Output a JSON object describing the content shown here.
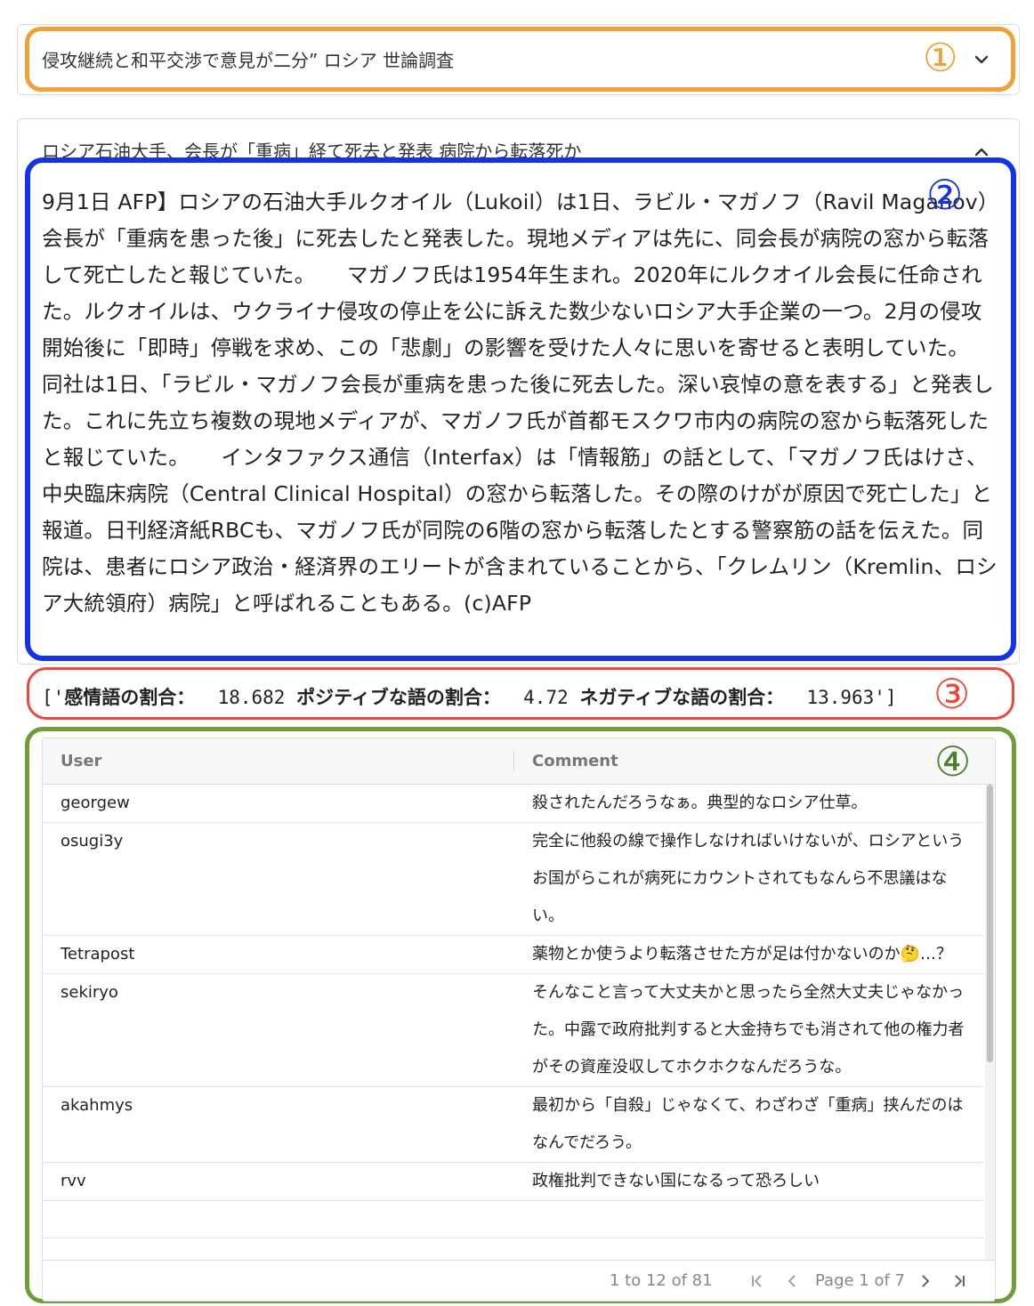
{
  "selector": {
    "selected_value": "侵攻継続と和平交渉で意見が二分” ロシア 世論調査",
    "chevron_icon": "chevron-down-icon"
  },
  "annotations": {
    "one": "①",
    "two": "②",
    "three": "③",
    "four": "④"
  },
  "annotation_colors": {
    "one": "#f0a23a",
    "two": "#1433e6",
    "three": "#e84b3c",
    "four": "#6e9e3a"
  },
  "article": {
    "title": "ロシア石油大手、会長が「重病」経て死去と発表 病院から転落死か",
    "collapse_icon": "chevron-up-icon",
    "body": "9月1日 AFP】ロシアの石油大手ルクオイル（Lukoil）は1日、ラビル・マガノフ（Ravil Maganov）会長が「重病を患った後」に死去したと発表した。現地メディアは先に、同会長が病院の窓から転落して死亡したと報じていた。　　マガノフ氏は1954年生まれ。2020年にルクオイル会長に任命された。ルクオイルは、ウクライナ侵攻の停止を公に訴えた数少ないロシア大手企業の一つ。2月の侵攻開始後に「即時」停戦を求め、この「悲劇」の影響を受けた人々に思いを寄せると表明していた。　　同社は1日、「ラビル・マガノフ会長が重病を患った後に死去した。深い哀悼の意を表する」と発表した。これに先立ち複数の現地メディアが、マガノフ氏が首都モスクワ市内の病院の窓から転落死したと報じていた。　　インタファクス通信（Interfax）は「情報筋」の話として、「マガノフ氏はけさ、中央臨床病院（Central Clinical Hospital）の窓から転落した。その際のけがが原因で死亡した」と報道。日刊経済紙RBCも、マガノフ氏が同院の6階の窓から転落したとする警察筋の話を伝えた。同院は、患者にロシア政治・経済界のエリートが含まれていることから、「クレムリン（Kremlin、ロシア大統領府）病院」と呼ばれることもある。(c)AFP"
  },
  "stats": {
    "open": "['",
    "emotion_label": "感情語の割合：",
    "emotion_value": "18.682",
    "positive_label": "ポジティブな語の割合：",
    "positive_value": "4.72",
    "negative_label": "ネガティブな語の割合：",
    "negative_value": "13.963",
    "close": "']"
  },
  "grid": {
    "columns": [
      "User",
      "Comment"
    ],
    "rows": [
      {
        "user": "georgew",
        "comment": "殺されたんだろうなぁ。典型的なロシア仕草。"
      },
      {
        "user": "osugi3y",
        "comment": "完全に他殺の線で操作しなければいけないが、ロシアというお国がらこれが病死にカウントされてもなんら不思議はない。"
      },
      {
        "user": "Tetrapost",
        "comment": "薬物とか使うより転落させた方が足は付かないのか🤔…？"
      },
      {
        "user": "sekiryo",
        "comment": "そんなこと言って大丈夫かと思ったら全然大丈夫じゃなかった。中露で政府批判すると大金持ちでも消されて他の権力者がその資産没収してホクホクなんだろうな。"
      },
      {
        "user": "akahmys",
        "comment": "最初から「自殺」じゃなくて、わざわざ「重病」挟んだのはなんでだろう。"
      },
      {
        "user": "rvv",
        "comment": "政権批判できない国になるって恐ろしい"
      },
      {
        "user": "",
        "comment": ""
      }
    ],
    "pager": {
      "range": "1 to 12 of 81",
      "page": "Page 1 of 7",
      "icons": [
        "first-page-icon",
        "prev-page-icon",
        "next-page-icon",
        "last-page-icon"
      ]
    }
  }
}
